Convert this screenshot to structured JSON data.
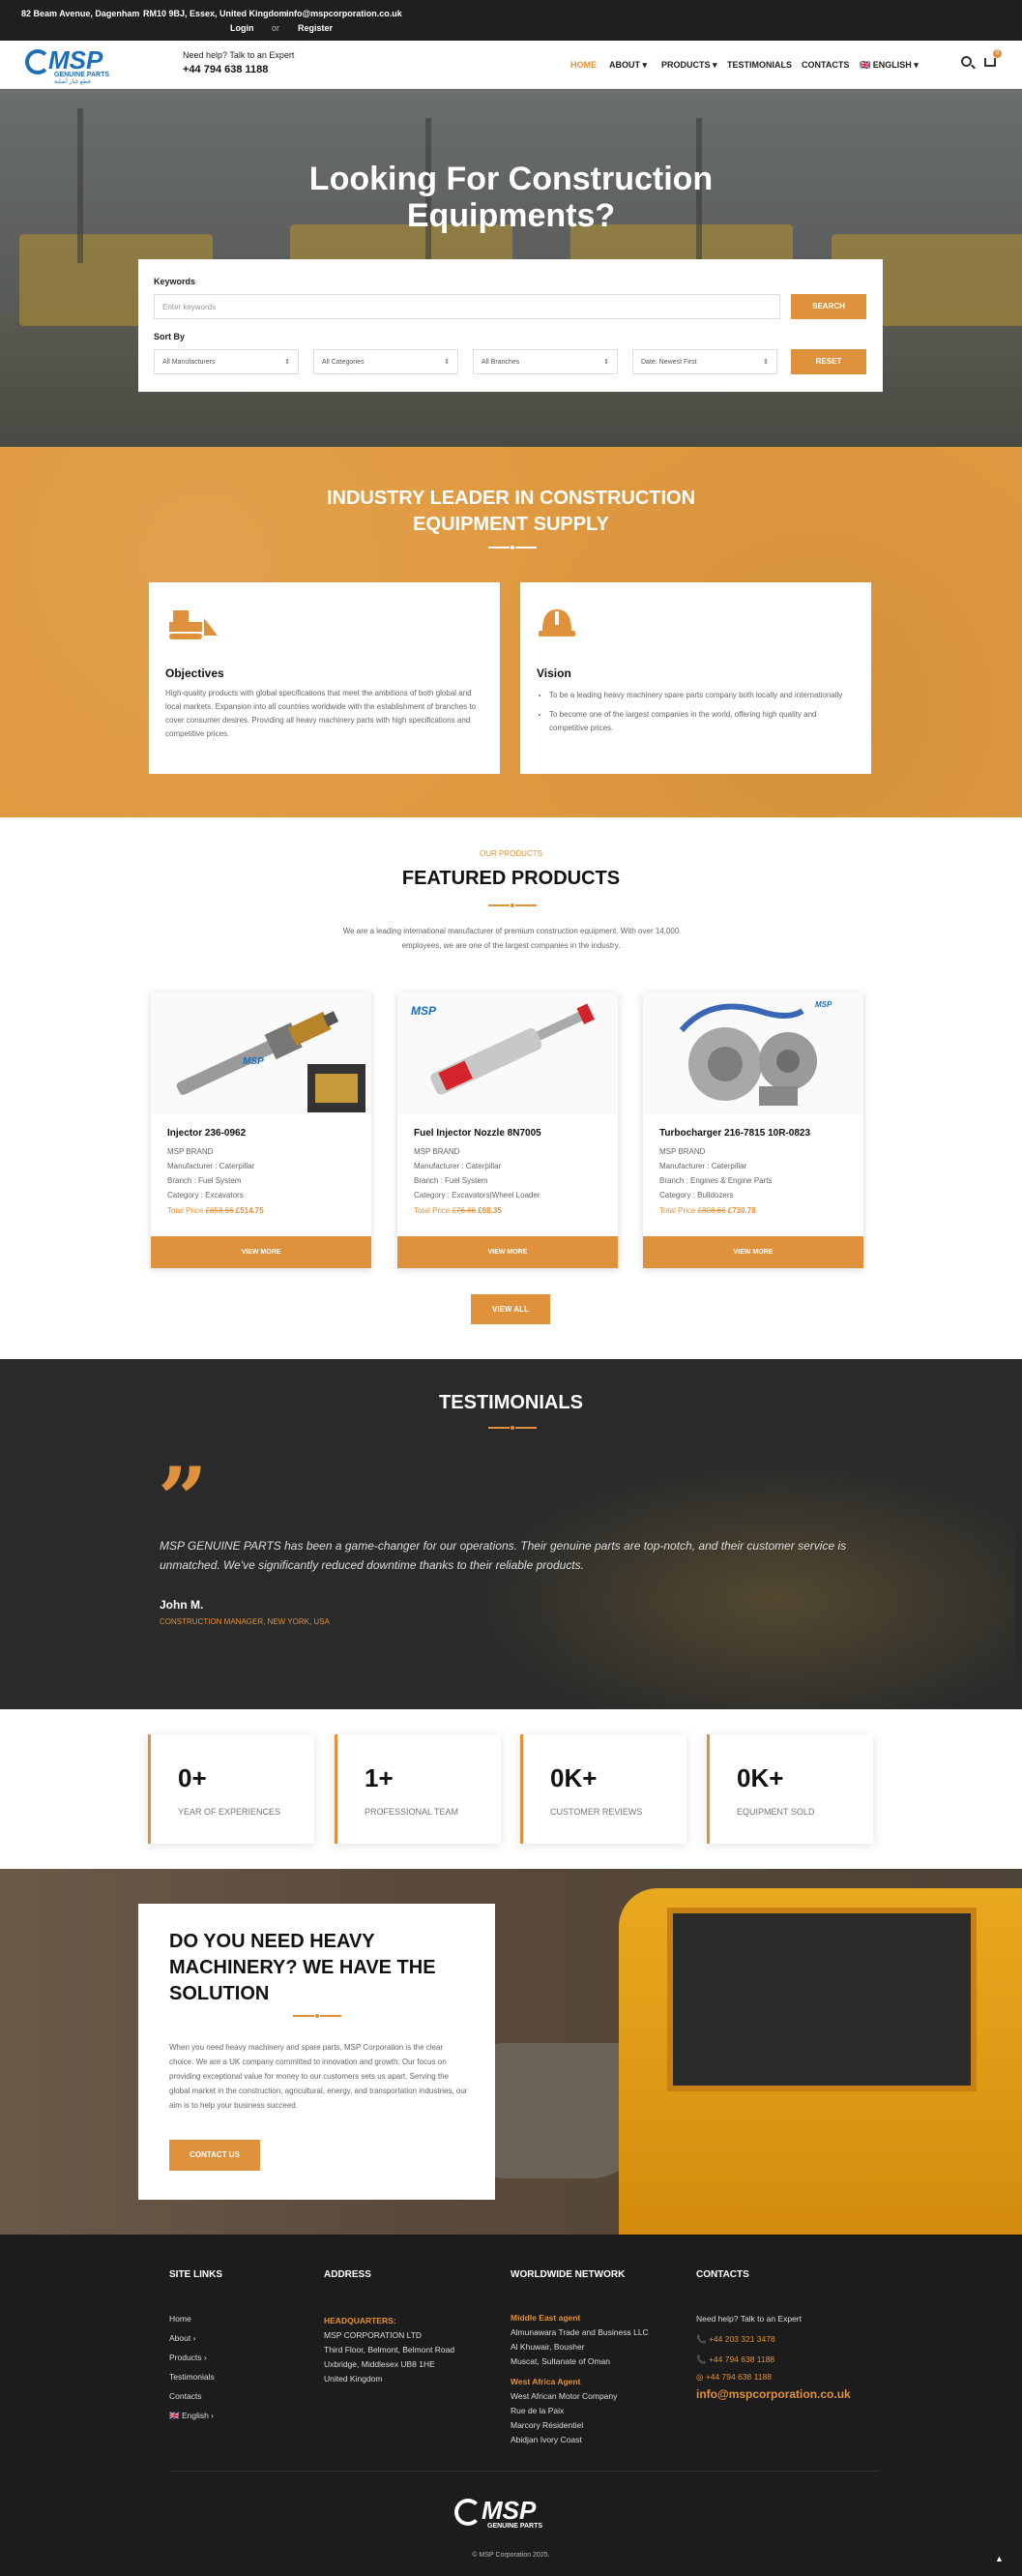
{
  "topbar": {
    "address_line1": "82 Beam Avenue, Dagenham",
    "address_line2": "RM10 9BJ, Essex, United Kingdom",
    "email": "info@mspcorporation.co.uk",
    "login": "Login",
    "or": "or",
    "register": "Register"
  },
  "header": {
    "logo_text": "MSP",
    "logo_sub": "GENUINE PARTS",
    "logo_sub_ar": "قطع غيار أصلية",
    "help_label": "Need help? Talk to an Expert",
    "phone": "+44 794 638 1188",
    "cart_count": "0",
    "nav": [
      {
        "label": "HOME"
      },
      {
        "label": "ABOUT ▾"
      },
      {
        "label": "PRODUCTS ▾"
      },
      {
        "label": "TESTIMONIALS"
      },
      {
        "label": "CONTACTS"
      },
      {
        "label": "🇬🇧 ENGLISH ▾"
      }
    ]
  },
  "hero": {
    "title_line1": "Looking For Construction",
    "title_line2": "Equipments?",
    "keywords_label": "Keywords",
    "keywords_placeholder": "Enter keywords",
    "search_button": "SEARCH",
    "sortby_label": "Sort By",
    "selects": [
      "All Manufacturers",
      "All Categories",
      "All Branches",
      "Date: Newest First"
    ],
    "reset_button": "RESET"
  },
  "industry": {
    "title_line1": "INDUSTRY LEADER IN CONSTRUCTION",
    "title_line2": "EQUIPMENT SUPPLY",
    "objectives_title": "Objectives",
    "objectives_text": "High-quality products with global specifications that meet the ambitions of both global and local markets. Expansion into all countries worldwide with the establishment of branches to cover consumer desires. Providing all heavy machinery parts with high specifications and competitive prices.",
    "vision_title": "Vision",
    "vision_items": [
      "To be a leading heavy machinery spare parts company both locally and internationally",
      "To become one of the largest companies in the world, offering high quality and competitive prices."
    ]
  },
  "featured": {
    "subtitle": "OUR PRODUCTS",
    "title": "FEATURED PRODUCTS",
    "description": "We are a leading international manufacturer of premium construction equipment. With over 14,000 employees, we are one of the largest companies in the industry.",
    "view_all": "VIEW ALL",
    "products": [
      {
        "name": "Injector 236-0962",
        "brand": "MSP BRAND",
        "manufacturer": "Manufacturer : Caterpillar",
        "branch": "Branch : Fuel System",
        "category": "Category : Excavators",
        "price_label": "Total Price",
        "old_price": "£658.66",
        "new_price": "£514.75",
        "button": "VIEW MORE"
      },
      {
        "name": "Fuel Injector Nozzle 8N7005",
        "brand": "MSP BRAND",
        "manufacturer": "Manufacturer : Caterpillar",
        "branch": "Branch : Fuel System",
        "category": "Category : Excavators|Wheel Loader",
        "price_label": "Total Price",
        "old_price": "£76.66",
        "new_price": "£68.35",
        "button": "VIEW MORE"
      },
      {
        "name": "Turbocharger 216-7815 10R-0823",
        "brand": "MSP BRAND",
        "manufacturer": "Manufacturer : Caterpillar",
        "branch": "Branch : Engines & Engine Parts",
        "category": "Category : Bulldozers",
        "price_label": "Total Price",
        "old_price": "£808.66",
        "new_price": "£730.78",
        "button": "VIEW MORE"
      }
    ]
  },
  "testimonials": {
    "title": "TESTIMONIALS",
    "quote": "MSP GENUINE PARTS has been a game-changer for our operations. Their genuine parts are top-notch, and their customer service is unmatched. We've significantly reduced downtime thanks to their reliable products.",
    "name": "John M.",
    "role": "CONSTRUCTION MANAGER, NEW YORK, USA"
  },
  "stats": [
    {
      "num": "0+",
      "cap": "YEAR OF EXPERIENCES"
    },
    {
      "num": "1+",
      "cap": "PROFESSIONAL TEAM"
    },
    {
      "num": "0K+",
      "cap": "CUSTOMER REVIEWS"
    },
    {
      "num": "0K+",
      "cap": "EQUIPMENT SOLD"
    }
  ],
  "heavy": {
    "title": "DO YOU NEED HEAVY MACHINERY? WE HAVE THE SOLUTION",
    "text": "When you need heavy machinery and spare parts, MSP Corporation is the clear choice. We are a UK company committed to innovation and growth. Our focus on providing exceptional value for money to our customers sets us apart. Serving the global market in the construction, agricultural, energy, and transportation industries, our aim is to help your business succeed.",
    "button": "CONTACT US"
  },
  "footer": {
    "site_links_title": "SITE LINKS",
    "site_links": [
      "Home",
      "About ›",
      "Products ›",
      "Testimonials",
      "Contacts",
      "🇬🇧 English ›"
    ],
    "address_title": "ADDRESS",
    "hq_label": "HEADQUARTERS:",
    "hq_lines": [
      "MSP CORPORATION LTD",
      "Third Floor, Belmont, Belmont Road",
      "Uxbridge, Middlesex UB8 1HE",
      "United Kingdom"
    ],
    "network_title": "WORLDWIDE NETWORK",
    "me_label": "Middle East agent",
    "me_lines": [
      "Almunawara Trade and Business LLC",
      "Al Khuwair, Bousher",
      "Muscat, Sultanate of Oman"
    ],
    "wa_label": "West Africa Agent",
    "wa_lines": [
      "West African Motor Company",
      "Rue de la Paix",
      "Marcory Résidentiel",
      "Abidjan Ivory Coast"
    ],
    "contacts_title": "CONTACTS",
    "contacts_help": "Need help? Talk to an Expert",
    "phones": [
      "📞 +44 203 321 3478",
      "📞 +44 794 638 1188",
      "◎ +44 794 638 1188"
    ],
    "email": "info@mspcorporation.co.uk",
    "copyright": "© MSP Corporation 2025."
  }
}
